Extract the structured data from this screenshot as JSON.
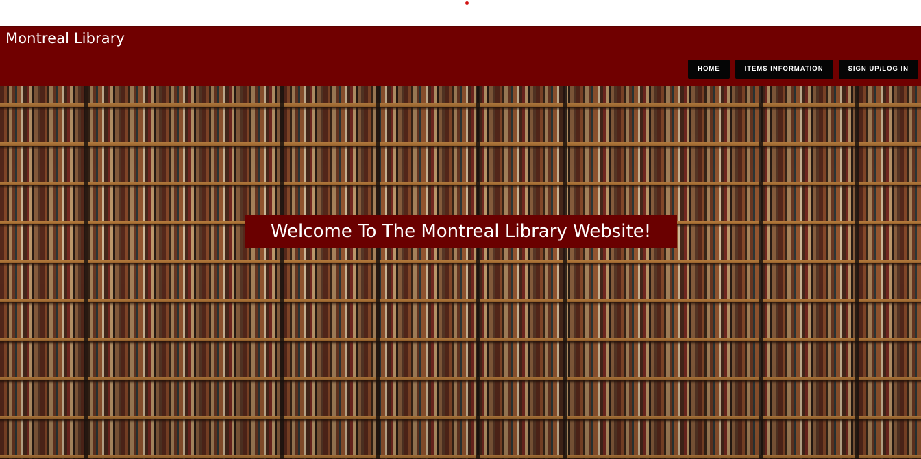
{
  "header": {
    "brand": "Montreal Library",
    "nav": [
      {
        "label": "HOME"
      },
      {
        "label": "ITEMS INFORMATION"
      },
      {
        "label": "SIGN UP/LOG IN"
      }
    ]
  },
  "hero": {
    "welcome_text": "Welcome To The Montreal Library Website!",
    "background": "bookshelf-image"
  },
  "colors": {
    "navbar": "#700000",
    "banner": "#6a0000",
    "nav_button": "#050505",
    "text": "#ffffff"
  }
}
